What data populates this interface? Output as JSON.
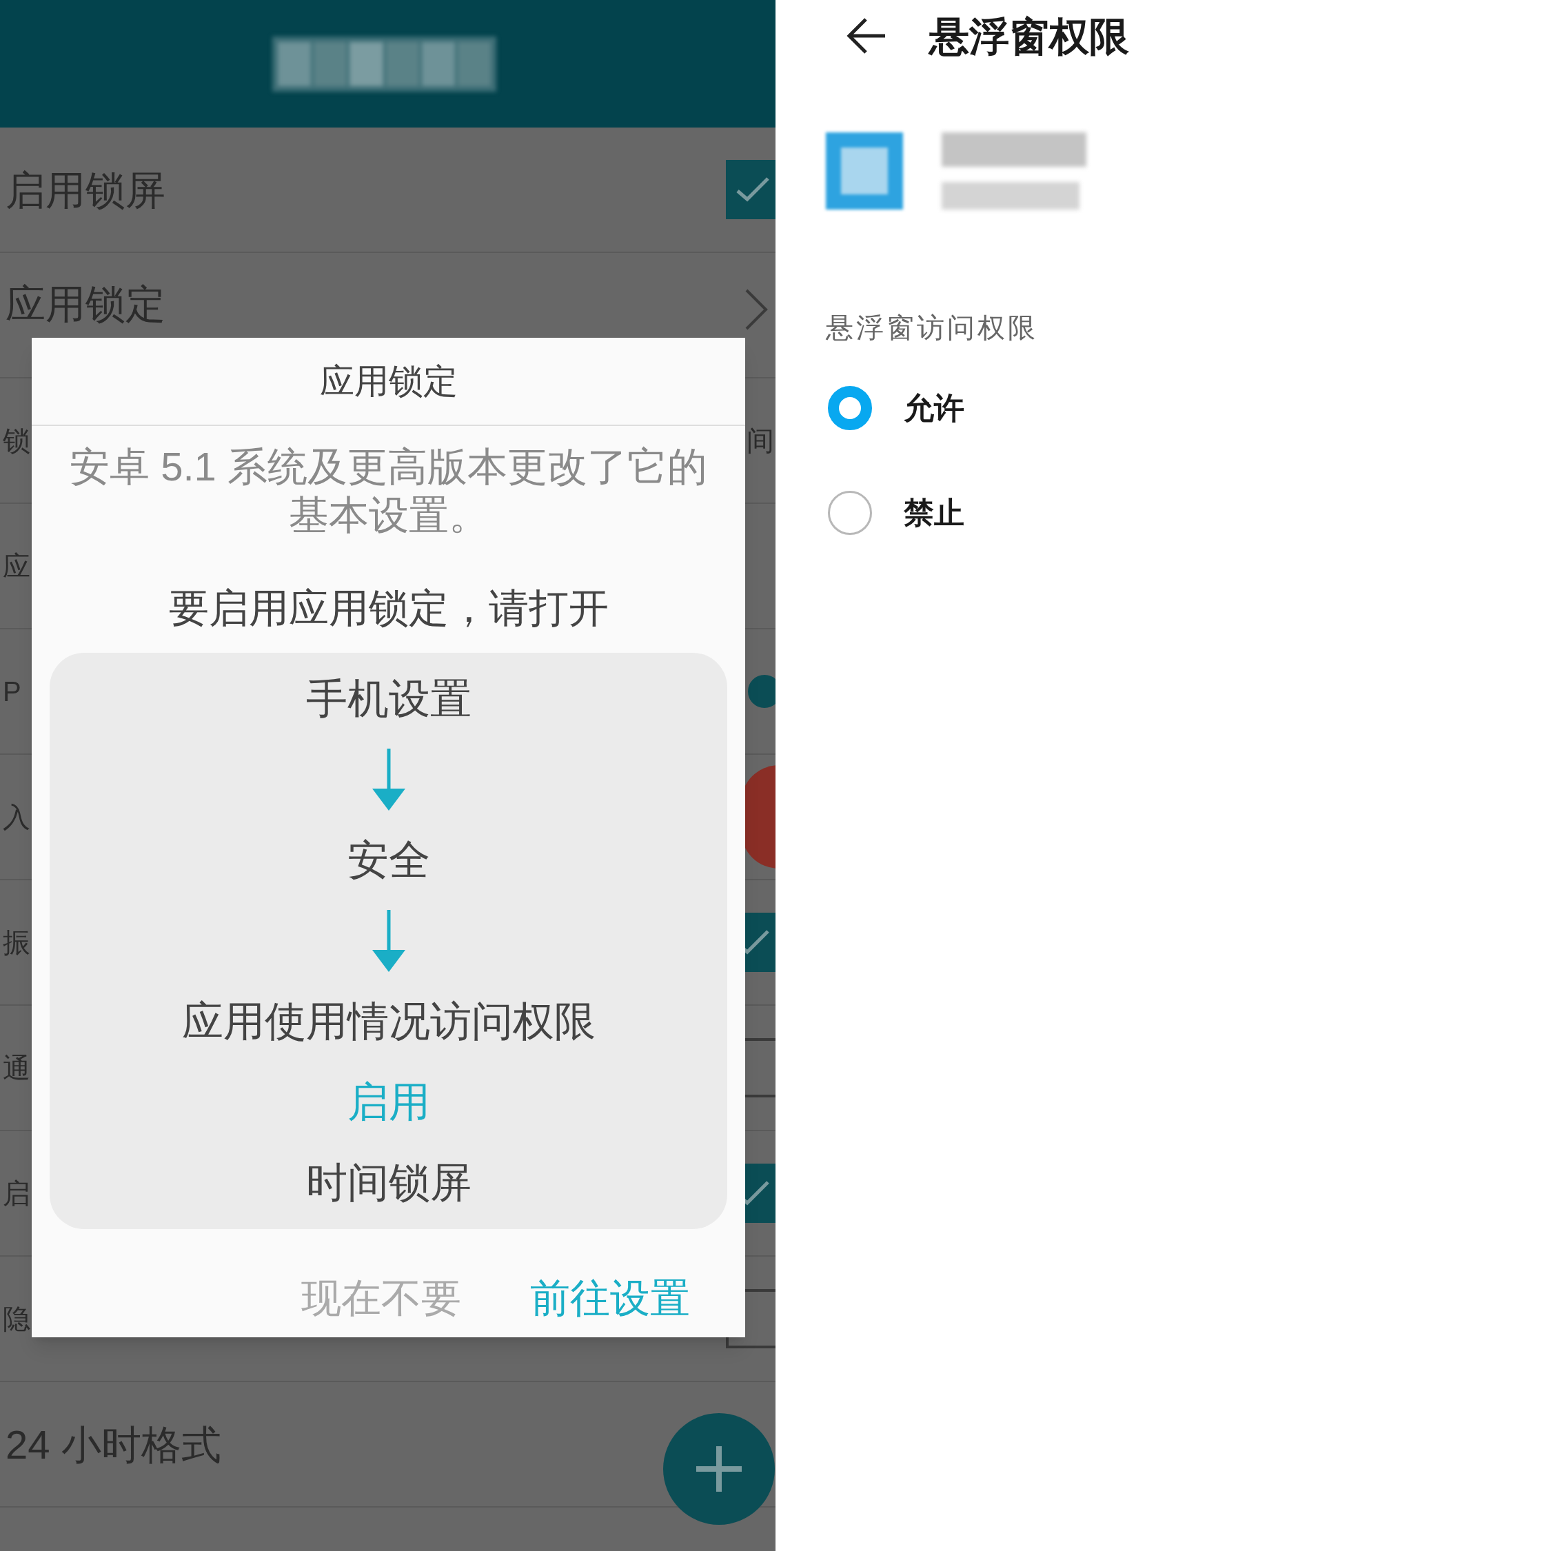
{
  "left_screen": {
    "settings_rows": [
      {
        "label": "启用锁屏",
        "kind": "checkbox",
        "checked": true
      },
      {
        "label": "应用锁定",
        "kind": "chevron"
      },
      {
        "label": "锁",
        "kind": "text",
        "value": "间"
      },
      {
        "label": "应",
        "kind": "plain"
      },
      {
        "label": "P",
        "kind": "toggle"
      },
      {
        "label": "入",
        "kind": "badge"
      },
      {
        "label": "振",
        "kind": "checkbox",
        "checked": true
      },
      {
        "label": "通",
        "kind": "checkbox",
        "checked": false
      },
      {
        "label": "启",
        "kind": "checkbox",
        "checked": true
      },
      {
        "label": "隐",
        "kind": "checkbox",
        "checked": false
      },
      {
        "label": "24 小时格式",
        "kind": "plain"
      }
    ],
    "dialog": {
      "title": "应用锁定",
      "message": "安卓 5.1 系统及更高版本更改了它的基本设置。",
      "instruction": "要启用应用锁定，请打开",
      "steps": [
        {
          "kind": "step",
          "text": "手机设置"
        },
        {
          "kind": "arrow"
        },
        {
          "kind": "step",
          "text": "安全"
        },
        {
          "kind": "arrow"
        },
        {
          "kind": "step",
          "text": "应用使用情况访问权限"
        },
        {
          "kind": "highlight",
          "text": "启用"
        },
        {
          "kind": "step",
          "text": "时间锁屏"
        }
      ],
      "buttons": [
        {
          "label": "现在不要",
          "kind": "secondary"
        },
        {
          "label": "前往设置",
          "kind": "primary"
        }
      ]
    }
  },
  "right_screen": {
    "title": "悬浮窗权限",
    "section_label": "悬浮窗访问权限",
    "options": [
      {
        "label": "允许",
        "selected": true
      },
      {
        "label": "禁止",
        "selected": false
      }
    ]
  }
}
